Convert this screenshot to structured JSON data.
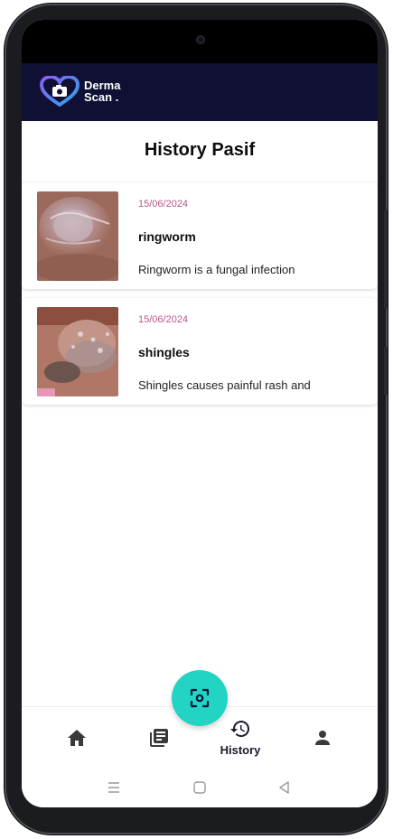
{
  "app": {
    "brand_line1": "Derma",
    "brand_line2": "Scan ."
  },
  "page": {
    "title": "History Pasif"
  },
  "history": [
    {
      "date": "15/06/2024",
      "name": "ringworm",
      "description": "Ringworm is a fungal infection",
      "image_icon": "skin-lesion-photo"
    },
    {
      "date": "15/06/2024",
      "name": "shingles",
      "description": "Shingles causes painful rash and",
      "image_icon": "skin-lesion-photo"
    }
  ],
  "bottom_nav": {
    "items": [
      {
        "icon": "home-icon",
        "label": ""
      },
      {
        "icon": "articles-icon",
        "label": ""
      },
      {
        "icon": "history-icon",
        "label": "History",
        "active": true
      },
      {
        "icon": "profile-icon",
        "label": ""
      }
    ],
    "fab_icon": "scan-icon"
  },
  "colors": {
    "appbar": "#0f1033",
    "accent_teal": "#21d4c4",
    "date_pink": "#b8578a"
  }
}
